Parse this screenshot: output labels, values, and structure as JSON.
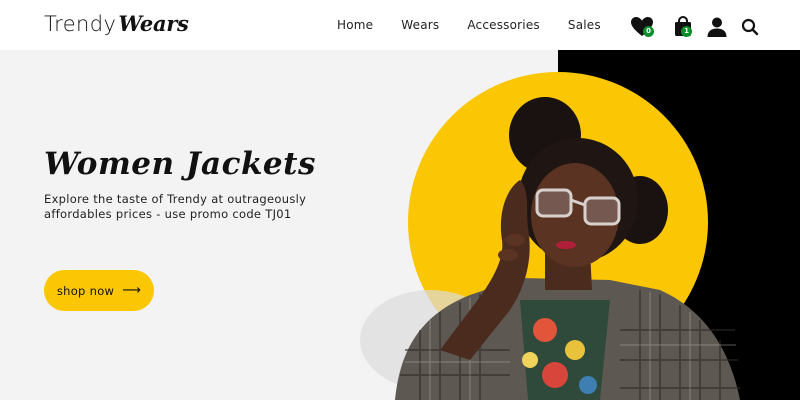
{
  "brand": {
    "name_part1": "Trendy",
    "name_part2": "Wears"
  },
  "nav": {
    "items": [
      {
        "label": "Home"
      },
      {
        "label": "Wears"
      },
      {
        "label": "Accessories"
      },
      {
        "label": "Sales"
      }
    ]
  },
  "header_icons": {
    "wishlist": {
      "icon": "heart-icon",
      "count": "0"
    },
    "cart": {
      "icon": "shopping-bag-icon",
      "count": "1"
    },
    "account": {
      "icon": "user-icon"
    },
    "search": {
      "icon": "search-icon"
    }
  },
  "hero": {
    "title": "Women Jackets",
    "subtitle": "Explore the taste of Trendy at outrageously affordables prices - use promo code TJ01",
    "cta_label": "shop now",
    "cta_icon": "arrow-right-icon"
  },
  "colors": {
    "accent": "#fbc704",
    "badge": "#0a8f2c",
    "hero_bg": "#f3f3f3",
    "dark_panel": "#000000"
  }
}
